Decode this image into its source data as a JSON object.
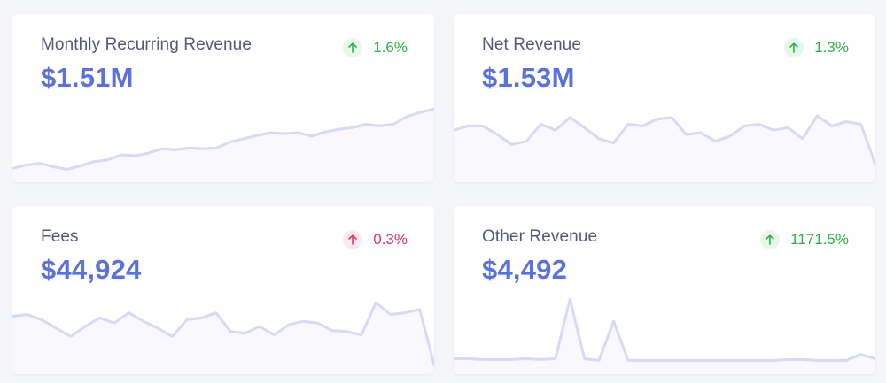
{
  "cards": [
    {
      "id": "monthly-recurring-revenue",
      "title": "Monthly Recurring Revenue",
      "value": "$1.51M",
      "change": "1.6%",
      "direction": "up",
      "trend_icon": "arrow-up-icon",
      "sparkline": [
        0.1,
        0.14,
        0.16,
        0.12,
        0.09,
        0.13,
        0.18,
        0.2,
        0.26,
        0.25,
        0.28,
        0.33,
        0.32,
        0.34,
        0.33,
        0.34,
        0.41,
        0.45,
        0.49,
        0.52,
        0.51,
        0.52,
        0.48,
        0.53,
        0.56,
        0.58,
        0.62,
        0.6,
        0.62,
        0.71,
        0.76,
        0.8
      ]
    },
    {
      "id": "net-revenue",
      "title": "Net Revenue",
      "value": "$1.53M",
      "change": "1.3%",
      "direction": "up",
      "trend_icon": "arrow-up-icon",
      "sparkline": [
        0.55,
        0.6,
        0.6,
        0.5,
        0.38,
        0.42,
        0.62,
        0.55,
        0.7,
        0.58,
        0.45,
        0.4,
        0.62,
        0.6,
        0.68,
        0.7,
        0.5,
        0.52,
        0.42,
        0.48,
        0.6,
        0.62,
        0.55,
        0.58,
        0.45,
        0.72,
        0.6,
        0.65,
        0.62,
        0.15
      ]
    },
    {
      "id": "fees",
      "title": "Fees",
      "value": "$44,924",
      "change": "0.3%",
      "direction": "down",
      "trend_icon": "arrow-up-icon",
      "sparkline": [
        0.62,
        0.64,
        0.58,
        0.48,
        0.38,
        0.5,
        0.6,
        0.54,
        0.66,
        0.56,
        0.48,
        0.38,
        0.58,
        0.6,
        0.66,
        0.44,
        0.42,
        0.5,
        0.4,
        0.52,
        0.56,
        0.54,
        0.45,
        0.44,
        0.4,
        0.78,
        0.64,
        0.66,
        0.7,
        0.05
      ]
    },
    {
      "id": "other-revenue",
      "title": "Other Revenue",
      "value": "$4,492",
      "change": "1171.5%",
      "direction": "up",
      "trend_icon": "arrow-up-icon",
      "sparkline": [
        0.12,
        0.12,
        0.11,
        0.11,
        0.11,
        0.12,
        0.11,
        0.12,
        0.82,
        0.12,
        0.1,
        0.56,
        0.1,
        0.1,
        0.1,
        0.1,
        0.1,
        0.1,
        0.1,
        0.1,
        0.1,
        0.1,
        0.1,
        0.11,
        0.11,
        0.1,
        0.1,
        0.1,
        0.17,
        0.12
      ]
    }
  ],
  "colors": {
    "line": "#d8d9f4",
    "fill": "#f8f8fd",
    "value": "#5b71e0",
    "title": "#55577d",
    "up": "#2cb34a",
    "down": "#e0336f"
  }
}
